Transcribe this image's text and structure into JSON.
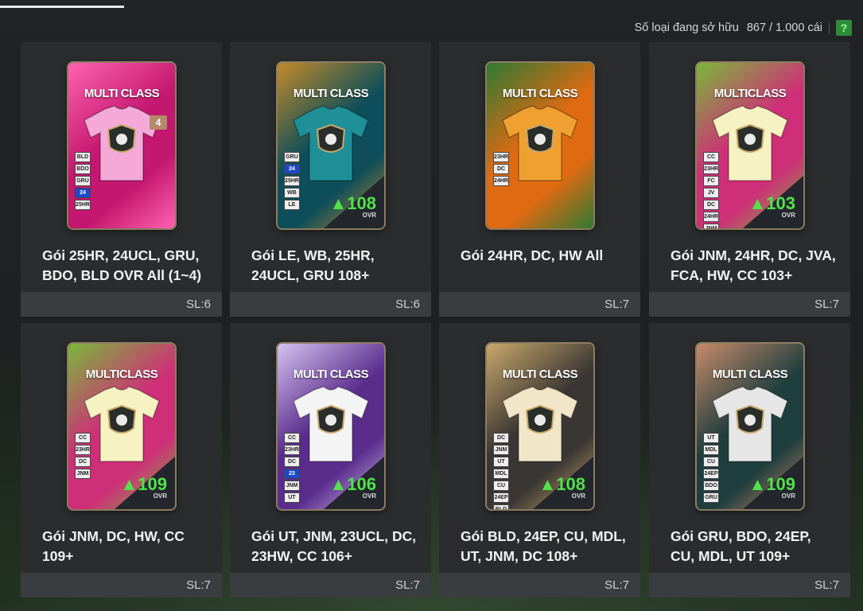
{
  "header": {
    "owned_label": "Số loại đang sở hữu",
    "owned_value": "867 / 1.000 cái",
    "help_label": "?"
  },
  "packs": [
    {
      "name": "Gói 25HR, 24UCL, GRU, BDO, BLD OVR All (1~4)",
      "sl": "SL:6",
      "title": "MULTI CLASS",
      "ovr": "",
      "count": "4",
      "badges": [
        "BLD",
        "BDO",
        "GRU",
        "24",
        "25HR"
      ],
      "bg": "#c4176f",
      "bg2": "#ff62b0",
      "shirt": "#f4a9d8"
    },
    {
      "name": "Gói LE, WB, 25HR, 24UCL, GRU 108+",
      "sl": "SL:6",
      "title": "MULTI CLASS",
      "ovr": "108",
      "count": "",
      "badges": [
        "GRU",
        "24",
        "25HR",
        "WB",
        "LE"
      ],
      "bg": "#0d4e5a",
      "bg2": "#c48a2a",
      "shirt": "#1f8f98"
    },
    {
      "name": "Gói 24HR, DC, HW All",
      "sl": "SL:7",
      "title": "MULTI CLASS",
      "ovr": "",
      "count": "",
      "badges": [
        "23HR",
        "DC",
        "24HR"
      ],
      "bg": "#e06a12",
      "bg2": "#2e7a33",
      "shirt": "#f0a030"
    },
    {
      "name": "Gói JNM, 24HR, DC, JVA, FCA, HW, CC 103+",
      "sl": "SL:7",
      "title": "MULTICLASS",
      "ovr": "103",
      "count": "",
      "badges": [
        "CC",
        "23HR",
        "FC",
        "JV",
        "DC",
        "24HR",
        "JNM"
      ],
      "bg": "#cf2e78",
      "bg2": "#7ab83a",
      "shirt": "#f6f2c2"
    },
    {
      "name": "Gói JNM, DC, HW, CC 109+",
      "sl": "SL:7",
      "title": "MULTICLASS",
      "ovr": "109",
      "count": "",
      "badges": [
        "CC",
        "23HR",
        "DC",
        "JNM"
      ],
      "bg": "#cf2e78",
      "bg2": "#7ab83a",
      "shirt": "#f6f2c2"
    },
    {
      "name": "Gói UT, JNM, 23UCL, DC, 23HW, CC 106+",
      "sl": "SL:7",
      "title": "MULTI CLASS",
      "ovr": "106",
      "count": "",
      "badges": [
        "CC",
        "23HR",
        "DC",
        "23",
        "JNM",
        "UT"
      ],
      "bg": "#5a2c8c",
      "bg2": "#d4c2f0",
      "shirt": "#f4f4f4"
    },
    {
      "name": "Gói BLD, 24EP, CU, MDL, UT, JNM, DC 108+",
      "sl": "SL:7",
      "title": "MULTI CLASS",
      "ovr": "108",
      "count": "",
      "badges": [
        "DC",
        "JNM",
        "UT",
        "MDL",
        "CU",
        "24EP",
        "BLD"
      ],
      "bg": "#3a3634",
      "bg2": "#c9a86a",
      "shirt": "#f2e6c8"
    },
    {
      "name": "Gói GRU, BDO, 24EP, CU, MDL, UT 109+",
      "sl": "SL:7",
      "title": "MULTI CLASS",
      "ovr": "109",
      "count": "",
      "badges": [
        "UT",
        "MDL",
        "CU",
        "24EP",
        "BDO",
        "GRU"
      ],
      "bg": "#1f3e3e",
      "bg2": "#c88a6a",
      "shirt": "#e6e6e6"
    }
  ]
}
